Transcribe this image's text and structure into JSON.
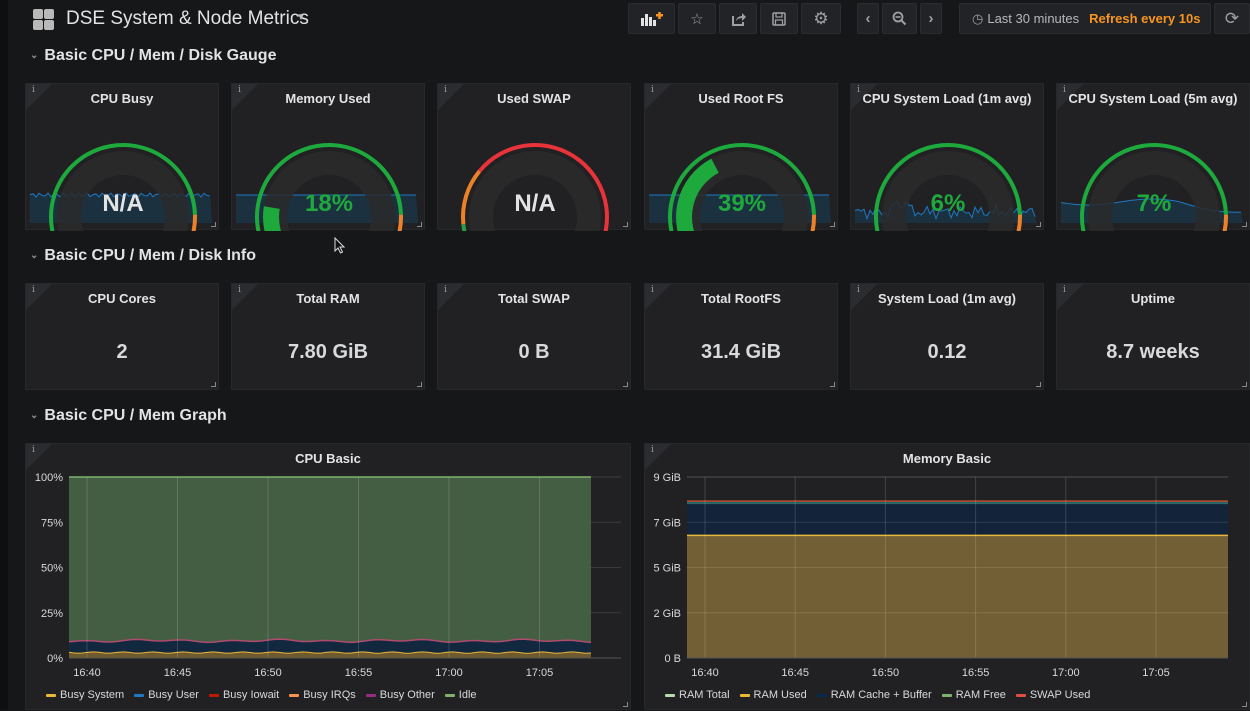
{
  "header": {
    "title": "DSE System & Node Metrics",
    "time_range": "Last 30 minutes",
    "refresh": "Refresh every 10s",
    "icons": [
      "add-panel-icon",
      "star-icon",
      "share-icon",
      "save-icon",
      "gear-icon",
      "chevron-left-icon",
      "zoom-out-icon",
      "chevron-right-icon",
      "clock-icon",
      "refresh-icon"
    ]
  },
  "rows": [
    {
      "title": "Basic CPU / Mem / Disk Gauge"
    },
    {
      "title": "Basic CPU / Mem / Disk Info"
    },
    {
      "title": "Basic CPU / Mem Graph"
    }
  ],
  "gauges": [
    {
      "title": "CPU Busy",
      "value": "N/A",
      "fraction": null,
      "thresholds": "green-orange-red",
      "sparkline": "flat"
    },
    {
      "title": "Memory Used",
      "value": "18%",
      "fraction": 0.18,
      "thresholds": "green-orange-red",
      "sparkline": "flat"
    },
    {
      "title": "Used SWAP",
      "value": "N/A",
      "fraction": null,
      "thresholds": "swap",
      "sparkline": "none"
    },
    {
      "title": "Used Root FS",
      "value": "39%",
      "fraction": 0.39,
      "thresholds": "green-orange-red",
      "sparkline": "flat"
    },
    {
      "title": "CPU System Load (1m avg)",
      "value": "6%",
      "fraction": 0.06,
      "thresholds": "green-orange-red",
      "sparkline": "noisy"
    },
    {
      "title": "CPU System Load (5m avg)",
      "value": "7%",
      "fraction": 0.07,
      "thresholds": "green-orange-red",
      "sparkline": "smooth"
    }
  ],
  "stats": [
    {
      "title": "CPU Cores",
      "value": "2"
    },
    {
      "title": "Total RAM",
      "value": "7.80 GiB"
    },
    {
      "title": "Total SWAP",
      "value": "0 B"
    },
    {
      "title": "Total RootFS",
      "value": "31.4 GiB"
    },
    {
      "title": "System Load (1m avg)",
      "value": "0.12"
    },
    {
      "title": "Uptime",
      "value": "8.7 weeks"
    }
  ],
  "colors": {
    "green": "#299c46",
    "gauge_green": "#1ea93d",
    "orange": "#ed8128",
    "red": "#e8333a",
    "accent": "#f79520",
    "sparkline": "#1f78c1"
  },
  "chart_data": [
    {
      "type": "area",
      "title": "CPU Basic",
      "x": [
        "16:40",
        "16:45",
        "16:50",
        "16:55",
        "17:00",
        "17:05"
      ],
      "yticks": [
        "0%",
        "25%",
        "50%",
        "75%",
        "100%"
      ],
      "ylim": [
        0,
        100
      ],
      "stacked": true,
      "series": [
        {
          "name": "Busy System",
          "color": "#eab839",
          "values": [
            3,
            3,
            3,
            3,
            3,
            3
          ]
        },
        {
          "name": "Busy User",
          "color": "#1f78c1",
          "values": [
            6,
            6,
            6,
            6,
            6,
            6
          ]
        },
        {
          "name": "Busy Iowait",
          "color": "#bf1b00",
          "values": [
            0.3,
            0.3,
            0.3,
            0.3,
            0.3,
            0.3
          ]
        },
        {
          "name": "Busy IRQs",
          "color": "#f9934e",
          "values": [
            0.1,
            0.1,
            0.1,
            0.1,
            0.1,
            0.1
          ]
        },
        {
          "name": "Busy Other",
          "color": "#962d82",
          "values": [
            0.2,
            0.2,
            0.2,
            0.2,
            0.2,
            0.2
          ]
        },
        {
          "name": "Idle",
          "color": "#7eb26d",
          "values": [
            90.4,
            90.4,
            90.4,
            90.4,
            90.4,
            90.4
          ]
        }
      ],
      "legend": "bottom"
    },
    {
      "type": "area",
      "title": "Memory Basic",
      "x": [
        "16:40",
        "16:45",
        "16:50",
        "16:55",
        "17:00",
        "17:05"
      ],
      "yticks": [
        "0 B",
        "2 GiB",
        "5 GiB",
        "7 GiB",
        "9 GiB"
      ],
      "ylim": [
        0,
        9
      ],
      "series": [
        {
          "name": "RAM Total",
          "color": "#b7dbab",
          "values": [
            7.8,
            7.8,
            7.8,
            7.8,
            7.8,
            7.8
          ]
        },
        {
          "name": "RAM Used",
          "color": "#eab839",
          "values": [
            6.1,
            6.1,
            6.1,
            6.1,
            6.1,
            6.1
          ]
        },
        {
          "name": "RAM Cache + Buffer",
          "color": "#052b51",
          "values": [
            1.55,
            1.55,
            1.55,
            1.55,
            1.55,
            1.55
          ]
        },
        {
          "name": "RAM Free",
          "color": "#7eb26d",
          "values": [
            0.15,
            0.15,
            0.15,
            0.15,
            0.15,
            0.15
          ]
        },
        {
          "name": "SWAP Used",
          "color": "#e24d42",
          "values": [
            0,
            0,
            0,
            0,
            0,
            0
          ]
        }
      ],
      "legend": "bottom"
    }
  ]
}
